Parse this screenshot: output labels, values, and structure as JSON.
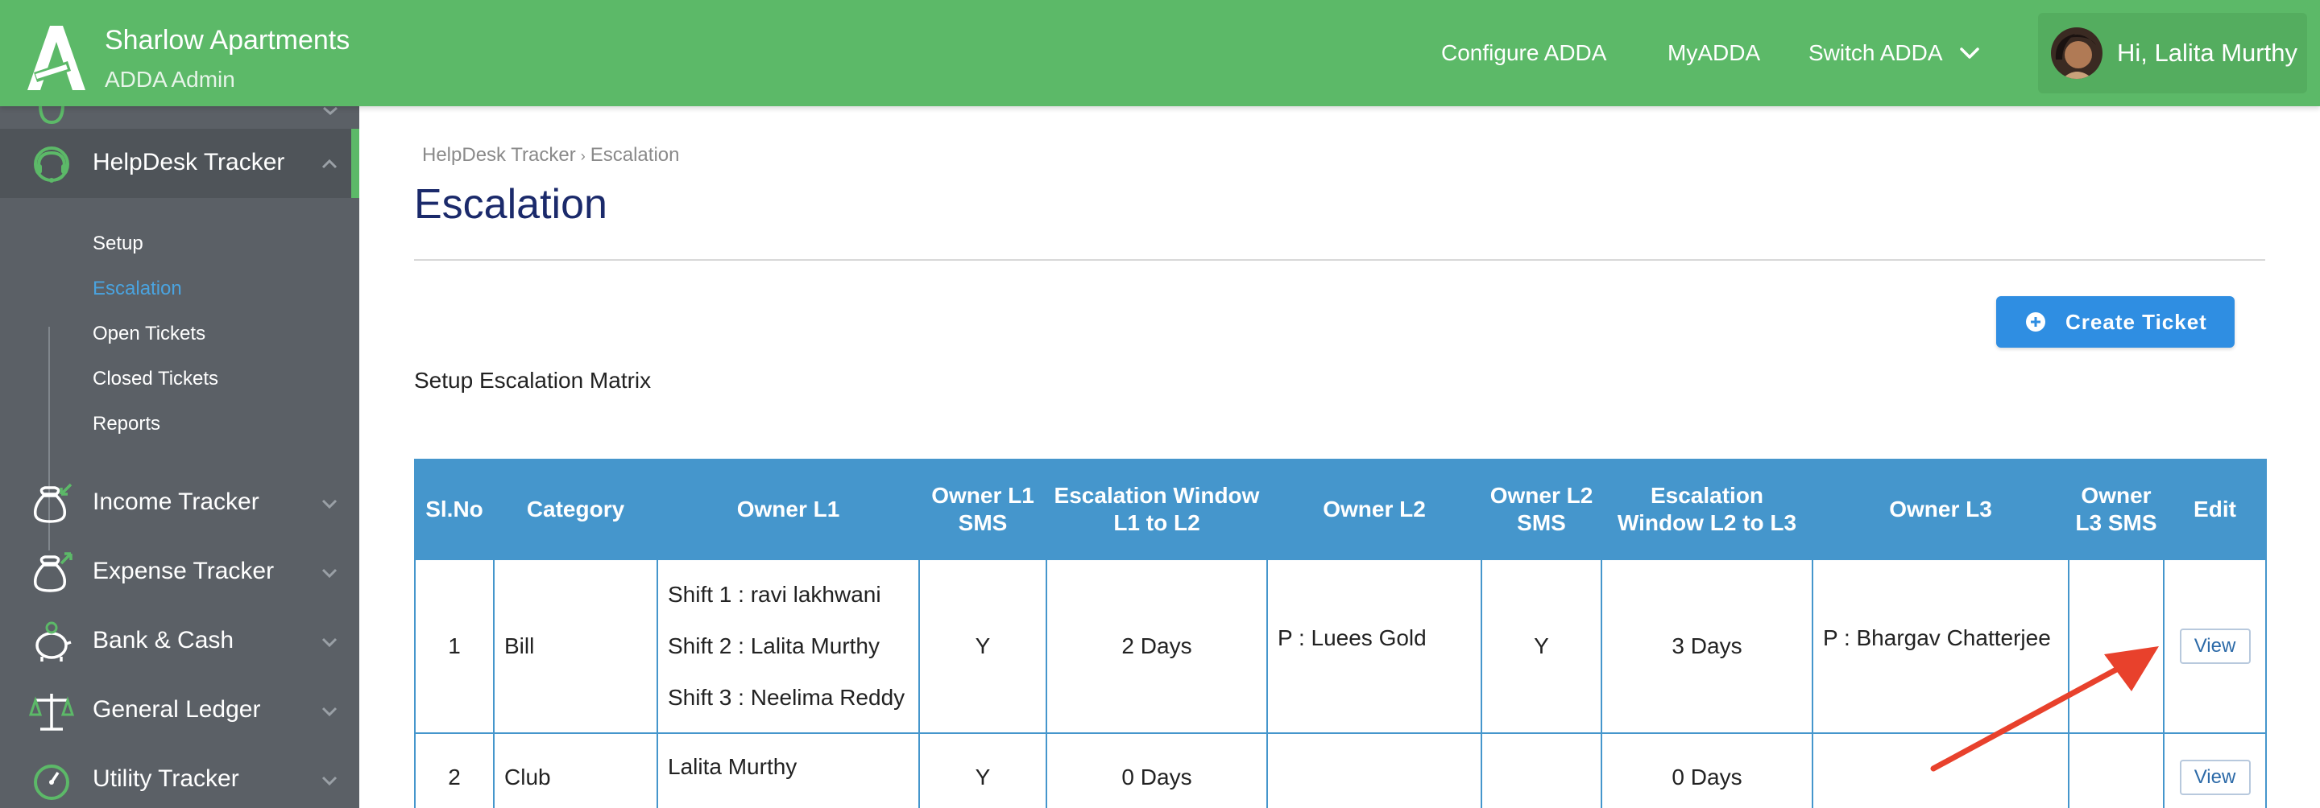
{
  "header": {
    "app_name": "Sharlow Apartments",
    "role": "ADDA Admin",
    "nav": {
      "configure": "Configure ADDA",
      "myadda": "MyADDA",
      "switch": "Switch ADDA"
    },
    "user_greeting": "Hi, Lalita Murthy"
  },
  "sidebar": {
    "active_section": "HelpDesk Tracker",
    "submenu": [
      "Setup",
      "Escalation",
      "Open Tickets",
      "Closed Tickets",
      "Reports"
    ],
    "active_submenu": "Escalation",
    "items": [
      "Income Tracker",
      "Expense Tracker",
      "Bank & Cash",
      "General Ledger",
      "Utility Tracker"
    ]
  },
  "breadcrumb": [
    "HelpDesk Tracker",
    "Escalation"
  ],
  "page_title": "Escalation",
  "create_button": "Create Ticket",
  "section_label": "Setup Escalation Matrix",
  "table": {
    "columns": [
      "Sl.No",
      "Category",
      "Owner L1",
      "Owner L1 SMS",
      "Escalation Window L1 to L2",
      "Owner L2",
      "Owner L2 SMS",
      "Escalation Window L2 to L3",
      "Owner L3",
      "Owner L3 SMS",
      "Edit"
    ],
    "rows": [
      {
        "slno": "1",
        "category": "Bill",
        "owner_l1": [
          "Shift 1 : ravi lakhwani",
          "Shift 2 : Lalita Murthy",
          "Shift 3 : Neelima Reddy"
        ],
        "owner_l1_sms": "Y",
        "window_l1_l2": "2 Days",
        "owner_l2": "P : Luees Gold",
        "owner_l2_sms": "Y",
        "window_l2_l3": "3 Days",
        "owner_l3": "P : Bhargav Chatterjee",
        "owner_l3_sms": "",
        "edit": "View"
      },
      {
        "slno": "2",
        "category": "Club",
        "owner_l1": [
          "Lalita Murthy"
        ],
        "owner_l1_sms": "Y",
        "window_l1_l2": "0 Days",
        "owner_l2": "",
        "owner_l2_sms": "",
        "window_l2_l3": "0 Days",
        "owner_l3": "",
        "owner_l3_sms": "",
        "edit": "View"
      }
    ]
  },
  "colors": {
    "header_green": "#5cb968",
    "sidebar_gray": "#5b6066",
    "table_header_blue": "#4596cc",
    "primary_button": "#2f8ee2",
    "annotation_arrow": "#e8412c"
  }
}
